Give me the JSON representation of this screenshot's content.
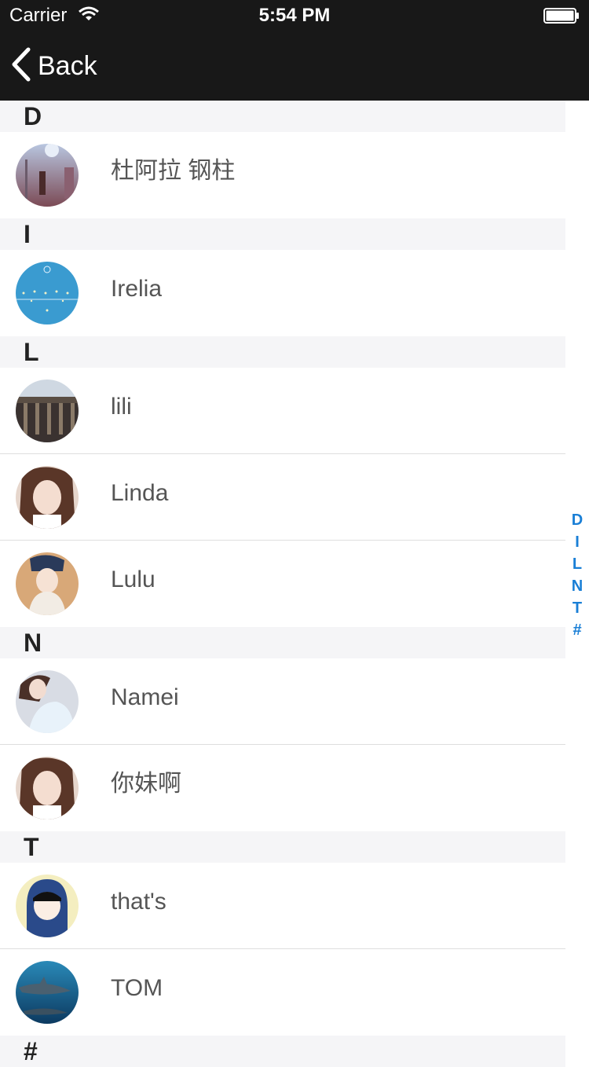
{
  "status": {
    "carrier": "Carrier",
    "time": "5:54 PM"
  },
  "nav": {
    "back_label": "Back"
  },
  "sections": {
    "d": {
      "letter": "D",
      "rows": [
        "杜阿拉  钢柱"
      ]
    },
    "i": {
      "letter": "I",
      "rows": [
        "Irelia"
      ]
    },
    "l": {
      "letter": "L",
      "rows": [
        "lili",
        "Linda",
        "Lulu"
      ]
    },
    "n": {
      "letter": "N",
      "rows": [
        "Namei",
        "你妹啊"
      ]
    },
    "t": {
      "letter": "T",
      "rows": [
        "that's",
        "TOM"
      ]
    },
    "hash": {
      "letter": "#"
    }
  },
  "index": [
    "D",
    "I",
    "L",
    "N",
    "T",
    "#"
  ],
  "colors": {
    "nav_bg": "#181818",
    "section_bg": "#f5f5f7",
    "index_color": "#1a7fd6"
  }
}
